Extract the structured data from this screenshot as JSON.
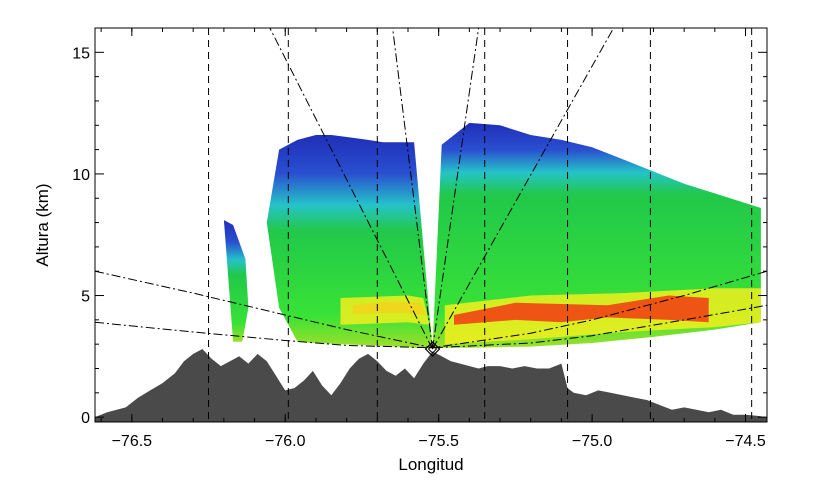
{
  "chart_data": {
    "type": "area",
    "title": "",
    "xlabel": "Longitud",
    "ylabel": "Altura (km)",
    "xlim": [
      -76.62,
      -74.43
    ],
    "ylim": [
      -0.2,
      16
    ],
    "x_ticks": [
      -76.5,
      -76.0,
      -75.5,
      -75.0,
      -74.5
    ],
    "x_tick_labels": [
      "−76.5",
      "−76.0",
      "−75.5",
      "−75.0",
      "−74.5"
    ],
    "y_ticks": [
      0,
      5,
      10,
      15
    ],
    "y_tick_labels": [
      "0",
      "5",
      "10",
      "15"
    ],
    "radar_site": {
      "lon": -75.52,
      "alt": 2.8
    },
    "colors": {
      "terrain": "#4a4a4a",
      "reflectivity": [
        "#1f2fb8",
        "#2a4fd0",
        "#25c3c9",
        "#21c84a",
        "#39e236",
        "#9fe02a",
        "#f2ee1e",
        "#f6a416",
        "#f23a12"
      ]
    },
    "terrain": {
      "x": [
        -76.62,
        -76.58,
        -76.52,
        -76.48,
        -76.44,
        -76.4,
        -76.36,
        -76.33,
        -76.3,
        -76.27,
        -76.24,
        -76.21,
        -76.18,
        -76.15,
        -76.12,
        -76.09,
        -76.06,
        -76.03,
        -76.0,
        -75.97,
        -75.94,
        -75.91,
        -75.88,
        -75.85,
        -75.82,
        -75.79,
        -75.76,
        -75.73,
        -75.7,
        -75.67,
        -75.64,
        -75.61,
        -75.58,
        -75.55,
        -75.52,
        -75.49,
        -75.46,
        -75.43,
        -75.4,
        -75.37,
        -75.34,
        -75.3,
        -75.26,
        -75.22,
        -75.18,
        -75.14,
        -75.1,
        -75.08,
        -75.06,
        -75.02,
        -74.98,
        -74.94,
        -74.9,
        -74.86,
        -74.82,
        -74.78,
        -74.74,
        -74.7,
        -74.66,
        -74.62,
        -74.58,
        -74.54,
        -74.5,
        -74.46,
        -74.43
      ],
      "y": [
        0.0,
        0.2,
        0.4,
        0.8,
        1.1,
        1.4,
        1.8,
        2.3,
        2.6,
        2.8,
        2.4,
        2.1,
        2.3,
        2.5,
        2.2,
        2.6,
        2.3,
        1.7,
        1.1,
        1.2,
        1.5,
        1.9,
        1.3,
        0.9,
        1.4,
        2.0,
        2.4,
        2.6,
        2.3,
        1.9,
        1.7,
        2.0,
        1.6,
        2.2,
        2.7,
        2.5,
        2.3,
        2.2,
        2.1,
        2.0,
        2.1,
        2.1,
        2.0,
        2.1,
        2.0,
        2.0,
        2.2,
        1.2,
        1.0,
        0.9,
        1.1,
        1.0,
        0.9,
        0.8,
        0.7,
        0.5,
        0.3,
        0.4,
        0.3,
        0.2,
        0.3,
        0.1,
        0.1,
        0.05,
        0.0
      ]
    },
    "elevation_arcs": [
      {
        "name": "",
        "x": [
          -76.62,
          -76.3,
          -76.0,
          -75.8,
          -75.52,
          -75.2,
          -75.0,
          -74.7,
          -74.43
        ],
        "y": [
          3.9,
          3.5,
          3.15,
          2.95,
          2.85,
          3.05,
          3.35,
          4.0,
          4.6
        ]
      },
      {
        "name": "",
        "x": [
          -76.62,
          -76.3,
          -76.0,
          -75.8,
          -75.52,
          -75.2,
          -75.0,
          -74.7,
          -74.43
        ],
        "y": [
          6.0,
          5.1,
          4.2,
          3.6,
          2.85,
          3.45,
          4.0,
          5.0,
          6.0
        ]
      }
    ],
    "radials": [
      {
        "x": [
          -75.52,
          -76.05
        ],
        "y": [
          2.8,
          16.0
        ]
      },
      {
        "x": [
          -75.52,
          -75.65
        ],
        "y": [
          2.8,
          16.0
        ]
      },
      {
        "x": [
          -75.52,
          -75.37
        ],
        "y": [
          2.8,
          16.0
        ]
      },
      {
        "x": [
          -75.52,
          -74.93
        ],
        "y": [
          2.8,
          16.0
        ]
      }
    ],
    "range_rings_lon": [
      -76.25,
      -75.99,
      -75.7,
      -75.35,
      -75.08,
      -74.81,
      -74.48
    ],
    "sectors": [
      {
        "name": "west",
        "outline_x": [
          -76.02,
          -75.96,
          -75.9,
          -75.85,
          -75.79,
          -75.73,
          -75.68,
          -75.62,
          -75.58,
          -75.52,
          -75.58,
          -75.64,
          -75.72,
          -75.82,
          -75.9,
          -75.96,
          -76.02,
          -76.06
        ],
        "outline_y": [
          11.0,
          11.4,
          11.6,
          11.6,
          11.5,
          11.4,
          11.3,
          11.3,
          11.3,
          2.85,
          2.85,
          2.9,
          2.95,
          3.0,
          3.05,
          3.1,
          4.5,
          8.0
        ],
        "bands": [
          {
            "level": 8,
            "x": [
              -75.78,
              -75.66,
              -75.56,
              -75.54,
              -75.62,
              -75.78
            ],
            "y": [
              4.6,
              4.75,
              4.7,
              4.2,
              4.3,
              4.25
            ]
          },
          {
            "level": 6,
            "x": [
              -75.82,
              -75.6,
              -75.55,
              -75.53,
              -75.6,
              -75.82
            ],
            "y": [
              4.9,
              5.0,
              4.9,
              3.8,
              3.9,
              3.8
            ]
          }
        ]
      },
      {
        "name": "east",
        "outline_x": [
          -75.52,
          -75.49,
          -75.4,
          -75.3,
          -75.2,
          -75.1,
          -75.0,
          -74.9,
          -74.8,
          -74.7,
          -74.6,
          -74.5,
          -74.45,
          -74.45,
          -74.6,
          -74.8,
          -75.0,
          -75.2,
          -75.4
        ],
        "outline_y": [
          2.85,
          11.2,
          12.1,
          12.0,
          11.6,
          11.4,
          11.1,
          10.6,
          10.1,
          9.6,
          9.2,
          8.8,
          8.6,
          3.9,
          3.6,
          3.3,
          3.05,
          2.9,
          2.85
        ],
        "bands": [
          {
            "level": 6,
            "x": [
              -75.48,
              -75.2,
              -74.9,
              -74.6,
              -74.45,
              -74.45,
              -74.6,
              -74.9,
              -75.2,
              -75.48
            ],
            "y": [
              4.6,
              5.0,
              5.1,
              5.3,
              5.3,
              3.9,
              3.7,
              3.5,
              3.2,
              3.0
            ]
          },
          {
            "level": 8,
            "x": [
              -75.45,
              -75.25,
              -75.1,
              -74.95,
              -74.75,
              -74.62,
              -74.62,
              -74.75,
              -74.95,
              -75.1,
              -75.25,
              -75.45
            ],
            "y": [
              4.2,
              4.7,
              4.65,
              4.6,
              5.0,
              4.9,
              3.9,
              4.0,
              4.1,
              3.9,
              4.0,
              3.8
            ]
          }
        ]
      },
      {
        "name": "isolated-west",
        "outline_x": [
          -76.2,
          -76.17,
          -76.13,
          -76.12,
          -76.14,
          -76.17
        ],
        "outline_y": [
          8.1,
          7.9,
          6.5,
          4.5,
          3.1,
          3.1
        ],
        "bands": []
      }
    ]
  }
}
